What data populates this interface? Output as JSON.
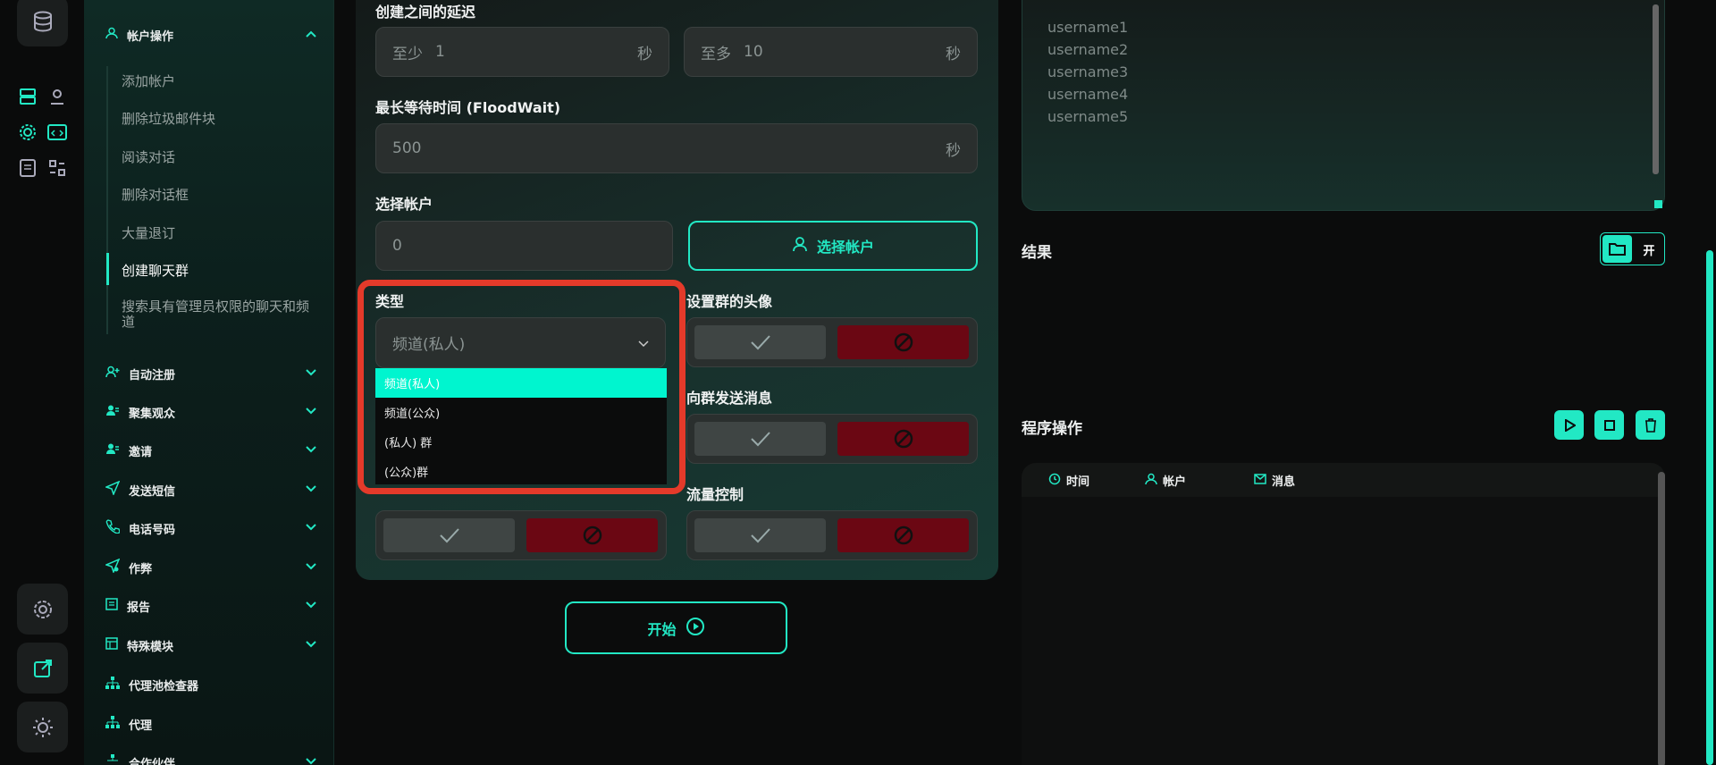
{
  "sidebar": {
    "account_ops": "帐户操作",
    "sub_items": [
      "添加帐户",
      "删除垃圾邮件块",
      "阅读对话",
      "删除对话框",
      "大量退订",
      "创建聊天群",
      "搜索具有管理员权限的聊天和频道"
    ],
    "sections": [
      "自动注册",
      "聚集观众",
      "邀请",
      "发送短信",
      "电话号码",
      "作弊",
      "报告",
      "特殊模块",
      "代理池检查器",
      "代理",
      "合作伙伴"
    ]
  },
  "form": {
    "delay_label": "创建之间的延迟",
    "min_prefix": "至少",
    "min_value": "1",
    "max_prefix": "至多",
    "max_value": "10",
    "unit_sec": "秒",
    "floodwait_label": "最长等待时间 (FloodWait)",
    "floodwait_value": "500",
    "select_account_label": "选择帐户",
    "account_count": "0",
    "select_account_btn": "选择帐户",
    "type_label": "类型",
    "type_selected": "频道(私人)",
    "avatar_label": "设置群的头像",
    "send_msg_label": "向群发送消息",
    "flow_label": "流量控制",
    "start_btn": "开始"
  },
  "dropdown": {
    "options": [
      "频道(私人)",
      "频道(公众)",
      "(私人) 群",
      "(公众)群"
    ],
    "selected_index": 0
  },
  "right": {
    "usernames": [
      "username1",
      "username2",
      "username3",
      "username4",
      "username5"
    ],
    "result_label": "结果",
    "result_toggle": "开",
    "ops_label": "程序操作",
    "log_cols": [
      "时间",
      "帐户",
      "消息"
    ]
  },
  "colors": {
    "accent": "#22e8c4",
    "danger": "#6b0713",
    "highlight": "#e43a2a"
  }
}
